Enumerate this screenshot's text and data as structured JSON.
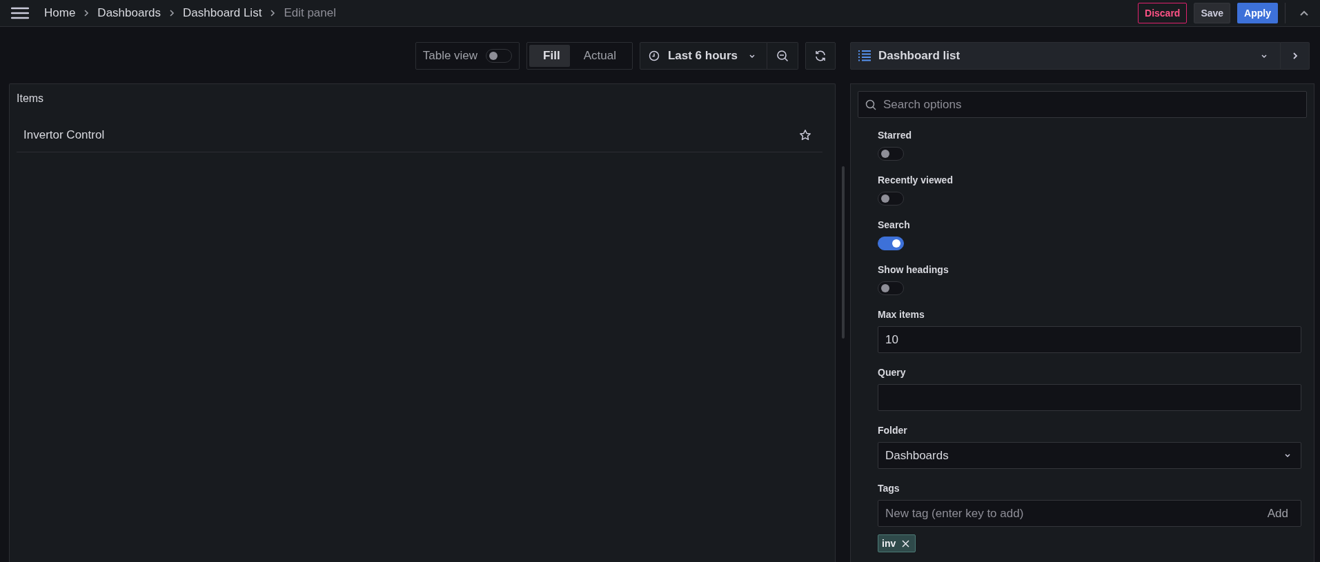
{
  "breadcrumbs": [
    {
      "label": "Home",
      "current": false
    },
    {
      "label": "Dashboards",
      "current": false
    },
    {
      "label": "Dashboard List",
      "current": false
    },
    {
      "label": "Edit panel",
      "current": true
    }
  ],
  "actions": [
    {
      "kind": "discard",
      "label": "Discard"
    },
    {
      "kind": "save",
      "label": "Save"
    },
    {
      "kind": "apply",
      "label": "Apply"
    }
  ],
  "toolbar": {
    "table_view": {
      "label": "Table view",
      "on": false
    },
    "display_modes": [
      {
        "label": "Fill",
        "selected": true
      },
      {
        "label": "Actual",
        "selected": false
      }
    ],
    "time_range": "Last 6 hours",
    "visualization": "Dashboard list"
  },
  "panel": {
    "title": "Items",
    "items": [
      {
        "title": "Invertor Control",
        "starred": false
      }
    ]
  },
  "options": {
    "search_placeholder": "Search options",
    "switches": [
      {
        "label": "Starred",
        "on": false
      },
      {
        "label": "Recently viewed",
        "on": false
      },
      {
        "label": "Search",
        "on": true
      },
      {
        "label": "Show headings",
        "on": false
      }
    ],
    "max_items": {
      "label": "Max items",
      "value": "10"
    },
    "query": {
      "label": "Query"
    },
    "folder": {
      "label": "Folder",
      "value": "Dashboards"
    },
    "tags": {
      "label": "Tags",
      "placeholder": "New tag (enter key to add)",
      "add_label": "Add",
      "items": [
        {
          "label": "inv"
        }
      ]
    }
  }
}
